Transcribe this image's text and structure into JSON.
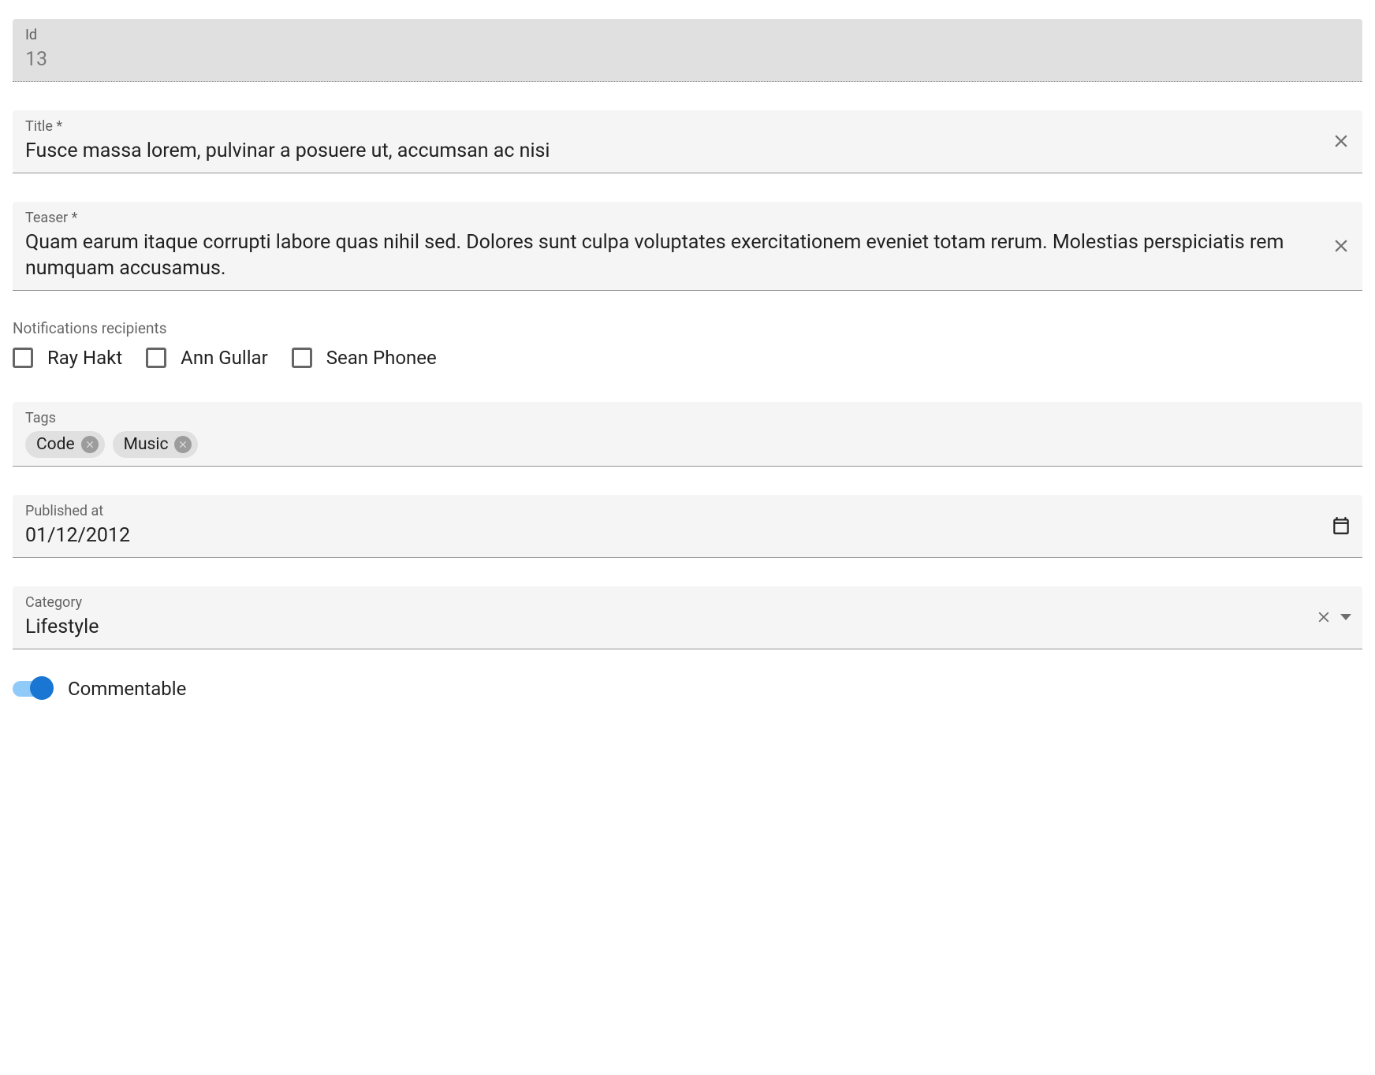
{
  "id_field": {
    "label": "Id",
    "value": "13"
  },
  "title_field": {
    "label": "Title *",
    "value": "Fusce massa lorem, pulvinar a posuere ut, accumsan ac nisi"
  },
  "teaser_field": {
    "label": "Teaser *",
    "value": "Quam earum itaque corrupti labore quas nihil sed. Dolores sunt culpa voluptates exercitationem eveniet totam rerum. Molestias perspiciatis rem numquam accusamus."
  },
  "recipients": {
    "label": "Notifications recipients",
    "options": [
      "Ray Hakt",
      "Ann Gullar",
      "Sean Phonee"
    ]
  },
  "tags_field": {
    "label": "Tags",
    "values": [
      "Code",
      "Music"
    ]
  },
  "published_field": {
    "label": "Published at",
    "value": "01/12/2012"
  },
  "category_field": {
    "label": "Category",
    "value": "Lifestyle"
  },
  "commentable": {
    "label": "Commentable",
    "checked": true
  }
}
